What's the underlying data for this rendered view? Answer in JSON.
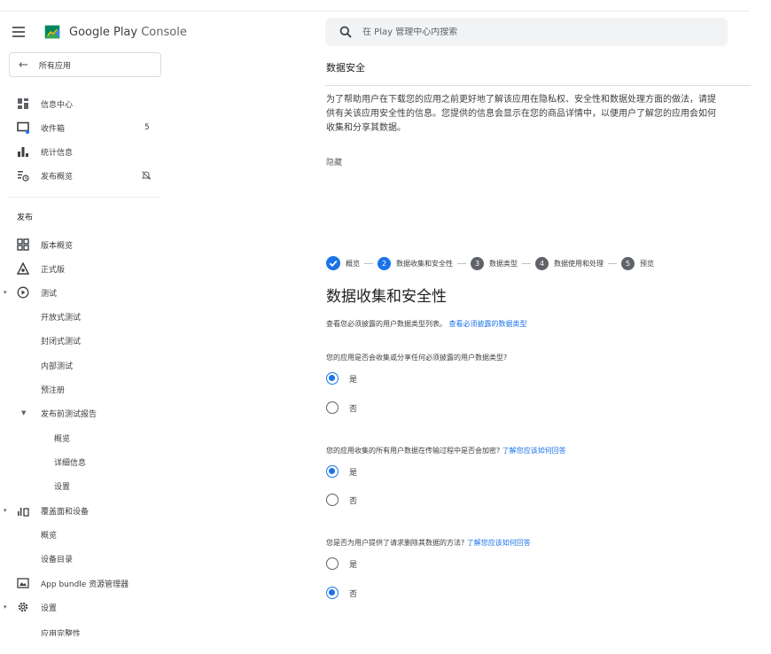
{
  "app": {
    "brand_primary": "Google Play",
    "brand_secondary": "Console"
  },
  "sidebar": {
    "all_apps": "所有应用",
    "top_items": [
      {
        "label": "信息中心",
        "icon": "dashboard-icon"
      },
      {
        "label": "收件箱",
        "icon": "inbox-icon",
        "badge": "5"
      },
      {
        "label": "统计信息",
        "icon": "bar-chart-icon"
      },
      {
        "label": "发布概览",
        "icon": "release-overview-icon"
      }
    ],
    "section_publish": "发布",
    "items": {
      "release_overview": "版本概览",
      "production": "正式版",
      "testing": "测试",
      "open_testing": "开放式测试",
      "closed_testing": "封闭式测试",
      "internal_testing": "内部测试",
      "pre_registration": "预注册",
      "pre_launch_report": "发布前测试报告",
      "pre_launch_overview": "概览",
      "pre_launch_details": "详细信息",
      "pre_launch_settings": "设置",
      "reach_devices": "覆盖面和设备",
      "reach_overview": "概览",
      "device_catalog": "设备目录",
      "app_bundle_explorer": "App bundle 资源管理器",
      "setup": "设置",
      "app_integrity": "应用完整性"
    }
  },
  "search": {
    "placeholder": "在 Play 管理中心内搜索"
  },
  "main": {
    "title": "数据安全",
    "intro": "为了帮助用户在下载您的应用之前更好地了解该应用在隐私权、安全性和数据处理方面的做法，请提供有关该应用安全性的信息。您提供的信息会显示在您的商品详情中，以便用户了解您的应用会如何收集和分享其数据。",
    "hide": "隐藏",
    "steps": [
      {
        "label": "概览",
        "state": "done"
      },
      {
        "number": "2",
        "label": "数据收集和安全性",
        "state": "active"
      },
      {
        "number": "3",
        "label": "数据类型",
        "state": "todo"
      },
      {
        "number": "4",
        "label": "数据使用和处理",
        "state": "todo"
      },
      {
        "number": "5",
        "label": "预览",
        "state": "todo"
      }
    ],
    "section_heading": "数据收集和安全性",
    "description": "查看您必须披露的用户数据类型列表。",
    "description_link": "查看必须披露的数据类型",
    "questions": [
      {
        "text": "您的应用是否会收集或分享任何必须披露的用户数据类型?",
        "link": "",
        "yes": "是",
        "no": "否",
        "selected": "yes"
      },
      {
        "text": "您的应用收集的所有用户数据在传输过程中是否会加密?",
        "link": "了解您应该如何回答",
        "yes": "是",
        "no": "否",
        "selected": "yes"
      },
      {
        "text": "您是否为用户提供了请求删除其数据的方法?",
        "link": "了解您应该如何回答",
        "yes": "是",
        "no": "否",
        "selected": "no"
      }
    ]
  },
  "colors": {
    "accent": "#1a73e8",
    "text": "#3c4043",
    "icon": "#5f6368"
  }
}
